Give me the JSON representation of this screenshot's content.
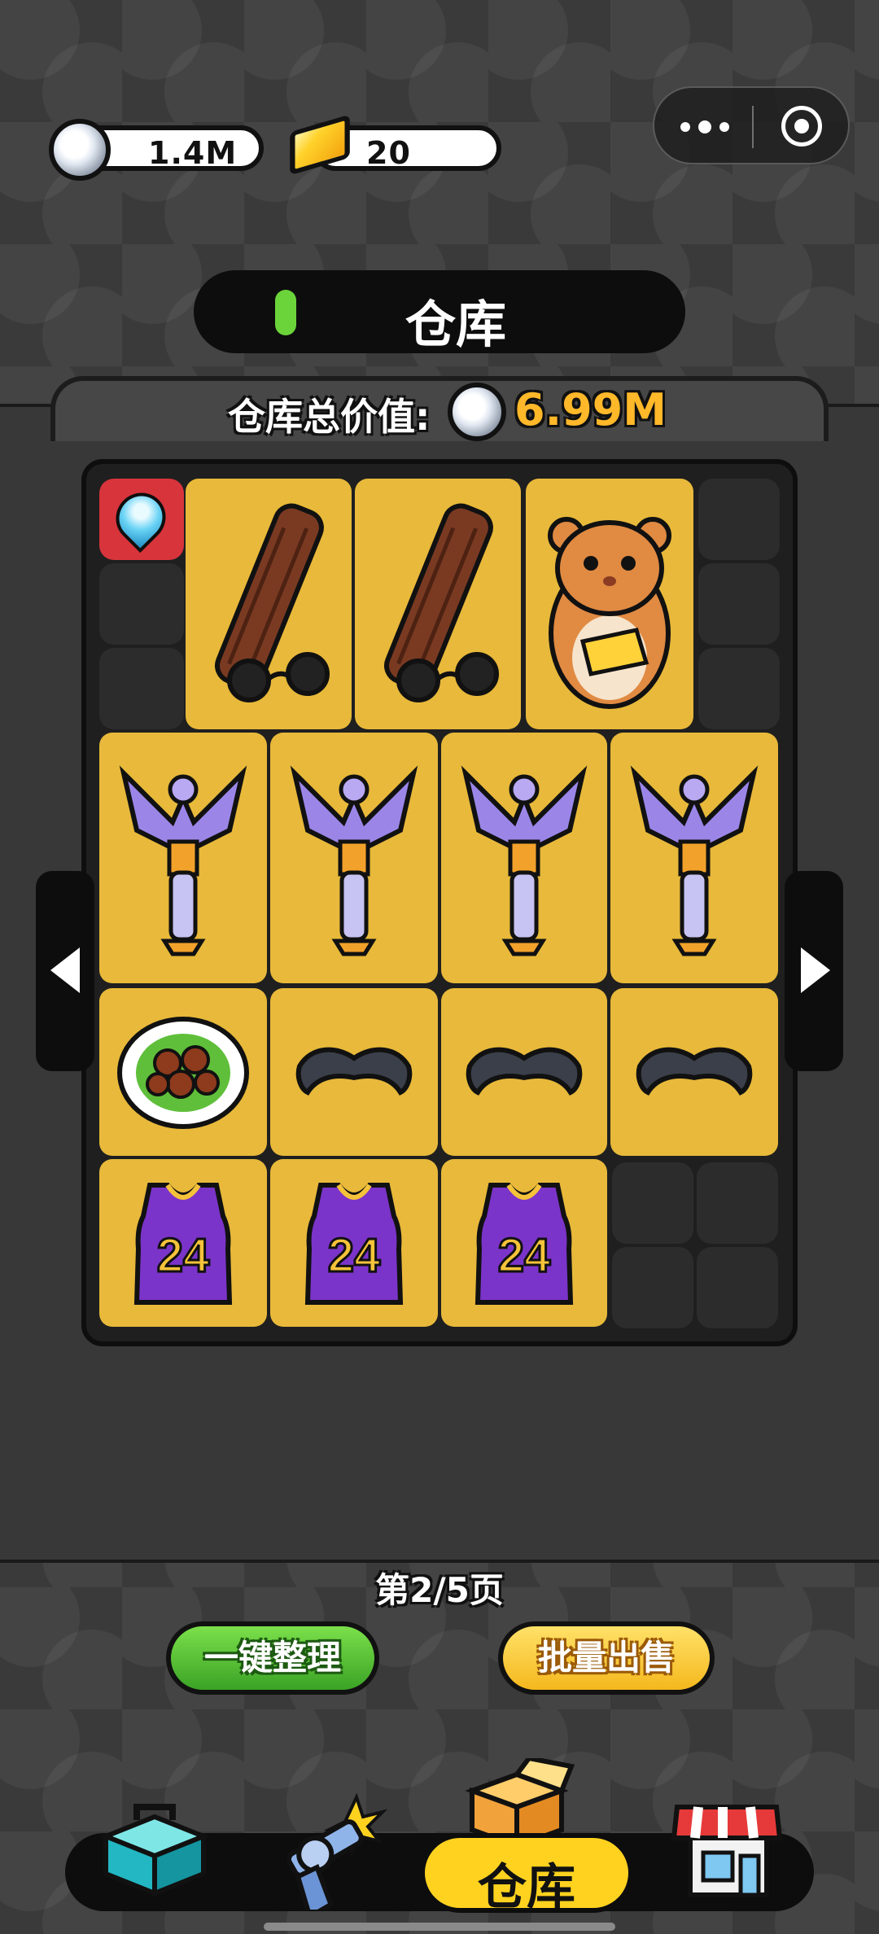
{
  "currency": {
    "silver": {
      "icon": "silver-coin-icon",
      "value": "1.4M"
    },
    "gold": {
      "icon": "gold-bar-icon",
      "value": "20"
    }
  },
  "capsule": {
    "more_icon": "more-dots-icon",
    "close_icon": "target-icon"
  },
  "header": {
    "title": "仓库"
  },
  "warehouse": {
    "total_label": "仓库总价值:",
    "total_value": "6.99M"
  },
  "items": [
    {
      "name": "log-with-sunglasses-icon"
    },
    {
      "name": "log-with-sunglasses-icon"
    },
    {
      "name": "hamster-with-gold-icon"
    },
    {
      "name": "purple-trophy-scepter-icon"
    },
    {
      "name": "purple-trophy-scepter-icon"
    },
    {
      "name": "purple-trophy-scepter-icon"
    },
    {
      "name": "purple-trophy-scepter-icon"
    },
    {
      "name": "meatball-plate-icon"
    },
    {
      "name": "black-mustache-icon"
    },
    {
      "name": "black-mustache-icon"
    },
    {
      "name": "black-mustache-icon"
    },
    {
      "name": "purple-jersey-icon",
      "label": "24"
    },
    {
      "name": "purple-jersey-icon",
      "label": "24"
    },
    {
      "name": "purple-jersey-icon",
      "label": "24"
    }
  ],
  "pagination": {
    "text": "第2/5页",
    "current": 2,
    "total": 5
  },
  "actions": {
    "organize": "一键整理",
    "bulk_sell": "批量出售"
  },
  "nav": {
    "items": [
      {
        "name": "toolbox-icon"
      },
      {
        "name": "revolver-icon"
      },
      {
        "name": "warehouse-box-icon",
        "label": "仓库",
        "active": true
      },
      {
        "name": "shop-icon"
      }
    ]
  },
  "colors": {
    "cell": "#e8b93a",
    "accent_green": "#6bd43a",
    "value_orange": "#ffb829"
  }
}
